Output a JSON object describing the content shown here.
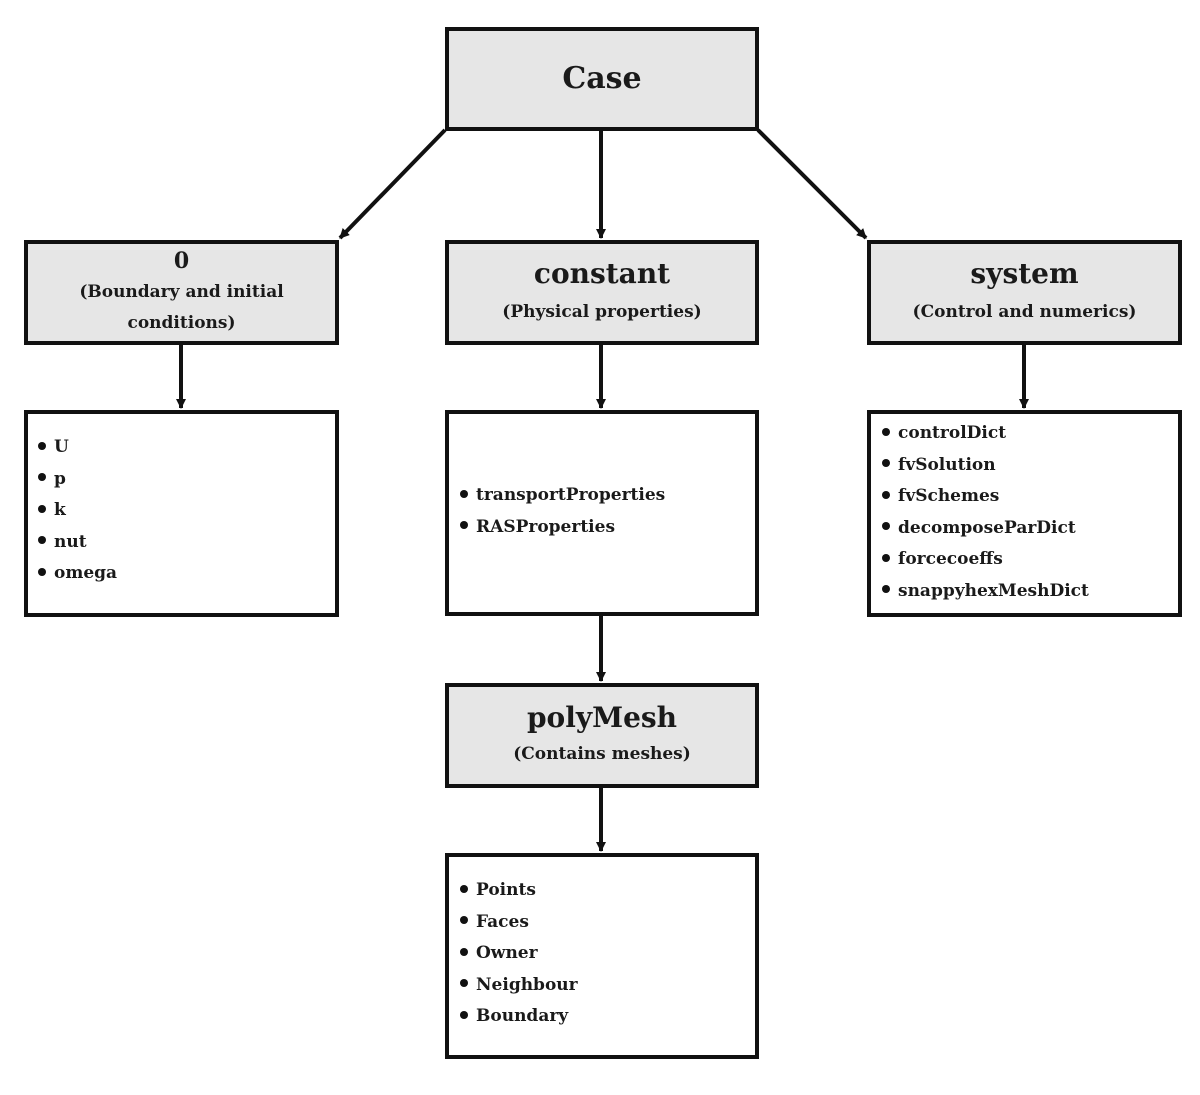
{
  "root": {
    "title": "Case"
  },
  "zero": {
    "title": "0",
    "subtitle_line1": "(Boundary and initial",
    "subtitle_line2": "conditions)",
    "items": [
      "U",
      "p",
      "k",
      "nut",
      "omega"
    ]
  },
  "constant": {
    "title": "constant",
    "subtitle": "(Physical properties)",
    "items": [
      "transportProperties",
      "RASProperties"
    ]
  },
  "system": {
    "title": "system",
    "subtitle": "(Control and numerics)",
    "items": [
      "controlDict",
      "fvSolution",
      "fvSchemes",
      "decomposeParDict",
      "forcecoeffs",
      "snappyhexMeshDict"
    ]
  },
  "polymesh": {
    "title": "polyMesh",
    "subtitle": "(Contains meshes)",
    "items": [
      "Points",
      "Faces",
      "Owner",
      "Neighbour",
      "Boundary"
    ]
  },
  "colors": {
    "header_fill": "#e6e6e6",
    "border": "#111111"
  }
}
